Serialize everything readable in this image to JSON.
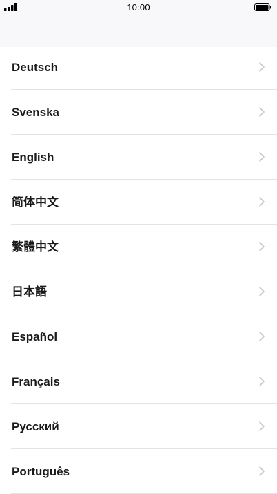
{
  "status_bar": {
    "time": "10:00",
    "signal_icon": "cellular-signal-icon",
    "battery_icon": "battery-full-icon"
  },
  "languages": [
    {
      "label": "Deutsch"
    },
    {
      "label": "Svenska"
    },
    {
      "label": "English"
    },
    {
      "label": "简体中文"
    },
    {
      "label": "繁體中文"
    },
    {
      "label": "日本語"
    },
    {
      "label": "Español"
    },
    {
      "label": "Français"
    },
    {
      "label": "Русский"
    },
    {
      "label": "Português"
    }
  ],
  "colors": {
    "header_background": "#f8f7fa",
    "list_background": "#ffffff",
    "label_text": "#1a1a1a",
    "chevron": "#c7c7cc",
    "divider": "#e3e3e6"
  }
}
